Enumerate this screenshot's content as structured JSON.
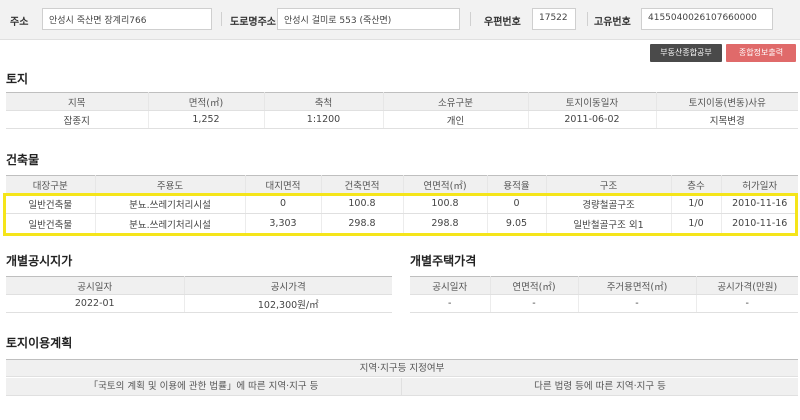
{
  "filters": {
    "address_label": "주소",
    "address_value": "안성시 죽산면 장계리766",
    "road_label": "도로명주소",
    "road_value": "안성시 걸미로 553 (죽산면)",
    "postal_label": "우편번호",
    "postal_value": "17522",
    "unique_label": "고유번호",
    "unique_value": "4155040026107660000"
  },
  "buttons": {
    "property_report": "부동산종합공부",
    "summary_print": "종합정보출력"
  },
  "land": {
    "title": "토지",
    "headers": [
      "지목",
      "면적(㎡)",
      "축척",
      "소유구분",
      "토지이동일자",
      "토지이동(변동)사유"
    ],
    "row": [
      "잡종지",
      "1,252",
      "1:1200",
      "개인",
      "2011-06-02",
      "지목변경"
    ]
  },
  "building": {
    "title": "건축물",
    "headers": [
      "대장구분",
      "주용도",
      "대지면적",
      "건축면적",
      "연면적(㎡)",
      "용적율",
      "구조",
      "층수",
      "허가일자"
    ],
    "rows": [
      [
        "일반건축물",
        "분뇨.쓰레기처리시설",
        "0",
        "100.8",
        "100.8",
        "0",
        "경량철골구조",
        "1/0",
        "2010-11-16"
      ],
      [
        "일반건축물",
        "분뇨.쓰레기처리시설",
        "3,303",
        "298.8",
        "298.8",
        "9.05",
        "일반철골구조 외1",
        "1/0",
        "2010-11-16"
      ]
    ]
  },
  "land_price": {
    "title": "개별공시지가",
    "headers": [
      "공시일자",
      "공시가격"
    ],
    "row": [
      "2022-01",
      "102,300원/㎡"
    ]
  },
  "house_price": {
    "title": "개별주택가격",
    "headers": [
      "공시일자",
      "연면적(㎡)",
      "주거용면적(㎡)",
      "공시가격(만원)"
    ],
    "row": [
      "-",
      "-",
      "-",
      "-"
    ]
  },
  "land_plan": {
    "title": "토지이용계획",
    "header": "지역·지구등 지정여부",
    "sub_left": "「국토의 계획 및 이용에 관한 법률」에 따른 지역·지구 등",
    "sub_right": "다른 법령 등에 따른 지역·지구 등"
  },
  "colors": {
    "highlight": "#f5e51a",
    "btn_dark": "#4a4a4a",
    "btn_accent": "#e06a6a"
  }
}
